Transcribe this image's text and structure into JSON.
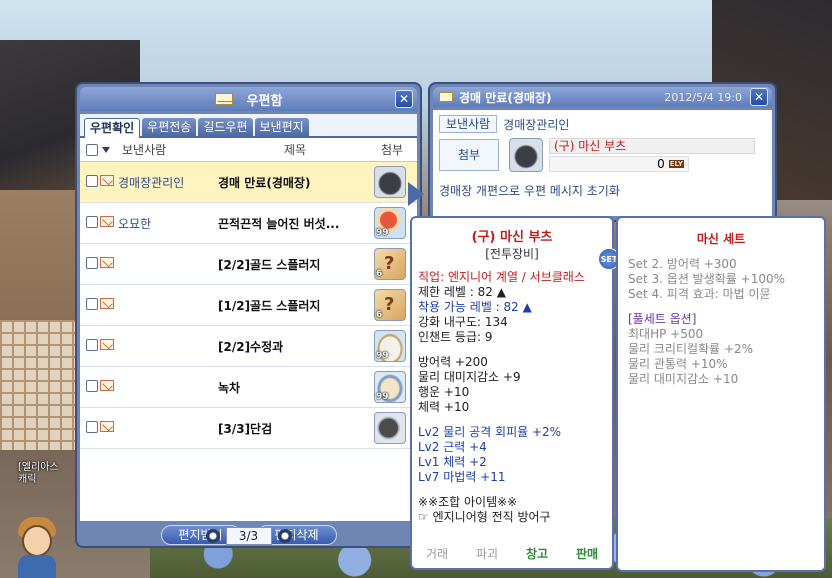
{
  "background": {
    "char_name_line1": "[엘리아스",
    "char_name_line2": "캐릭"
  },
  "mail_window": {
    "title": "우편함",
    "tabs": [
      "우편확인",
      "우편전송",
      "길드우편",
      "보낸편지"
    ],
    "columns": {
      "sender": "보낸사람",
      "subject": "제목",
      "attachment": "첨부"
    },
    "rows": [
      {
        "sender": "경매장관리인",
        "subject": "경매 만료(경매장)",
        "attachment_icon": "shoes",
        "qty": ""
      },
      {
        "sender": "오묘한",
        "subject": "끈적끈적 늘어진 버섯...",
        "attachment_icon": "hat",
        "qty": "99"
      },
      {
        "sender": "",
        "subject": "[2/2]골드 스플러지",
        "attachment_icon": "scroll",
        "qty": "6"
      },
      {
        "sender": "",
        "subject": "[1/2]골드 스플러지",
        "attachment_icon": "scroll",
        "qty": "6"
      },
      {
        "sender": "",
        "subject": "[2/2]수정과",
        "attachment_icon": "bowl",
        "qty": "99"
      },
      {
        "sender": "",
        "subject": "녹차",
        "attachment_icon": "pot",
        "qty": "99"
      },
      {
        "sender": "",
        "subject": "[3/3]단검",
        "attachment_icon": "dagger",
        "qty": ""
      }
    ],
    "pager": {
      "text": "3/3"
    },
    "buttons": {
      "receive": "편지받기",
      "delete": "편지삭제"
    }
  },
  "read_window": {
    "title": "경매 만료(경매장)",
    "date": "2012/5/4 19:0",
    "sender_label": "보낸사람",
    "sender_name": "경매장관리인",
    "attach_label": "첨부",
    "item_name": "(구) 마신 부츠",
    "price": "0",
    "price_unit": "ELY",
    "message": "경매장 개편으로 우편 메시지 초기화"
  },
  "item_tooltip": {
    "name": "(구) 마신 부츠",
    "category": "[전투장비]",
    "set_badge": "SET",
    "job": "직업: 엔지니어 계열 / 서브클래스",
    "req_level": "제한 레벨 : 82 ▲",
    "usable_level": "착용 가능 레벨 : 82 ▲",
    "durability": "강화 내구도: 134",
    "enchant": "인챈트 등급: 9",
    "stats": [
      "방어력 +200",
      "물리 대미지감소 +9",
      "행운 +10",
      "체력 +10"
    ],
    "options": [
      "Lv2 물리 공격 회피율 +2%",
      "Lv2 근력 +4",
      "Lv1 체력 +2",
      "Lv7 마법력 +11"
    ],
    "combo_title": "※※조합 아이템※※",
    "combo_desc": "☞ 엔지니어형 전직 방어구",
    "actions": [
      "거래",
      "파괴",
      "창고",
      "판매"
    ]
  },
  "set_tooltip": {
    "title": "마신 세트",
    "set_effects": [
      "Set 2.  방어력 +300",
      "Set 3.  옵션 발생확률 +100%",
      "Set 4.  피격 효과: 마법 이뮨"
    ],
    "full_set_title": "[풀세트 옵션]",
    "full_set_effects": [
      "최대HP +500",
      "물리 크리티컬확률 +2%",
      "물리 관통력 +10%",
      "물리 대미지감소 +10"
    ]
  }
}
